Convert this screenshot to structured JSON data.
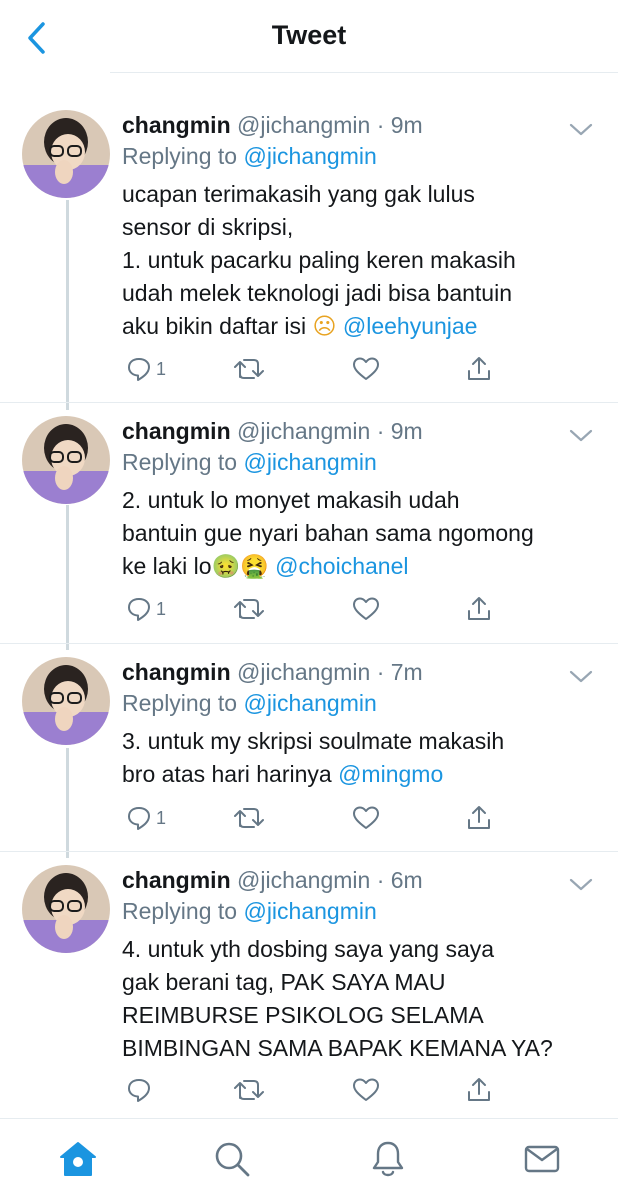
{
  "header": {
    "title": "Tweet",
    "back_icon": "chevron-left-icon"
  },
  "colors": {
    "accent": "#1b95e0",
    "secondary_text": "#657786",
    "text": "#14171a",
    "divider": "#e6ecf0"
  },
  "tweets": [
    {
      "name": "changmin",
      "handle": "@jichangmin",
      "dot": "·",
      "time": "9m",
      "reply_prefix": "Replying to",
      "reply_to": "@jichangmin",
      "text_lines": [
        "ucapan terimakasih yang gak lulus",
        "sensor di skripsi,",
        "1. untuk pacarku paling keren makasih",
        "udah melek teknologi jadi bisa bantuin",
        "aku bikin daftar isi"
      ],
      "emoji": "☹",
      "mention": "@leehyunjae",
      "reply_count": "1"
    },
    {
      "name": "changmin",
      "handle": "@jichangmin",
      "dot": "·",
      "time": "9m",
      "reply_prefix": "Replying to",
      "reply_to": "@jichangmin",
      "text_lines": [
        "2. untuk lo monyet makasih udah",
        "bantuin gue nyari bahan sama ngomong",
        "ke laki lo"
      ],
      "emoji": "🤢🤮",
      "mention": "@choichanel",
      "reply_count": "1"
    },
    {
      "name": "changmin",
      "handle": "@jichangmin",
      "dot": "·",
      "time": "7m",
      "reply_prefix": "Replying to",
      "reply_to": "@jichangmin",
      "text_lines": [
        "3. untuk my skripsi soulmate makasih",
        "bro atas hari harinya"
      ],
      "mention": "@mingmo",
      "reply_count": "1"
    },
    {
      "name": "changmin",
      "handle": "@jichangmin",
      "dot": "·",
      "time": "6m",
      "reply_prefix": "Replying to",
      "reply_to": "@jichangmin",
      "text_lines": [
        "4. untuk yth dosbing saya yang saya",
        "gak berani tag, PAK SAYA MAU",
        "REIMBURSE PSIKOLOG SELAMA",
        "BIMBINGAN SAMA BAPAK KEMANA YA?"
      ],
      "reply_count": ""
    }
  ],
  "bottom_nav": [
    "home-icon",
    "search-icon",
    "notifications-icon",
    "messages-icon"
  ]
}
